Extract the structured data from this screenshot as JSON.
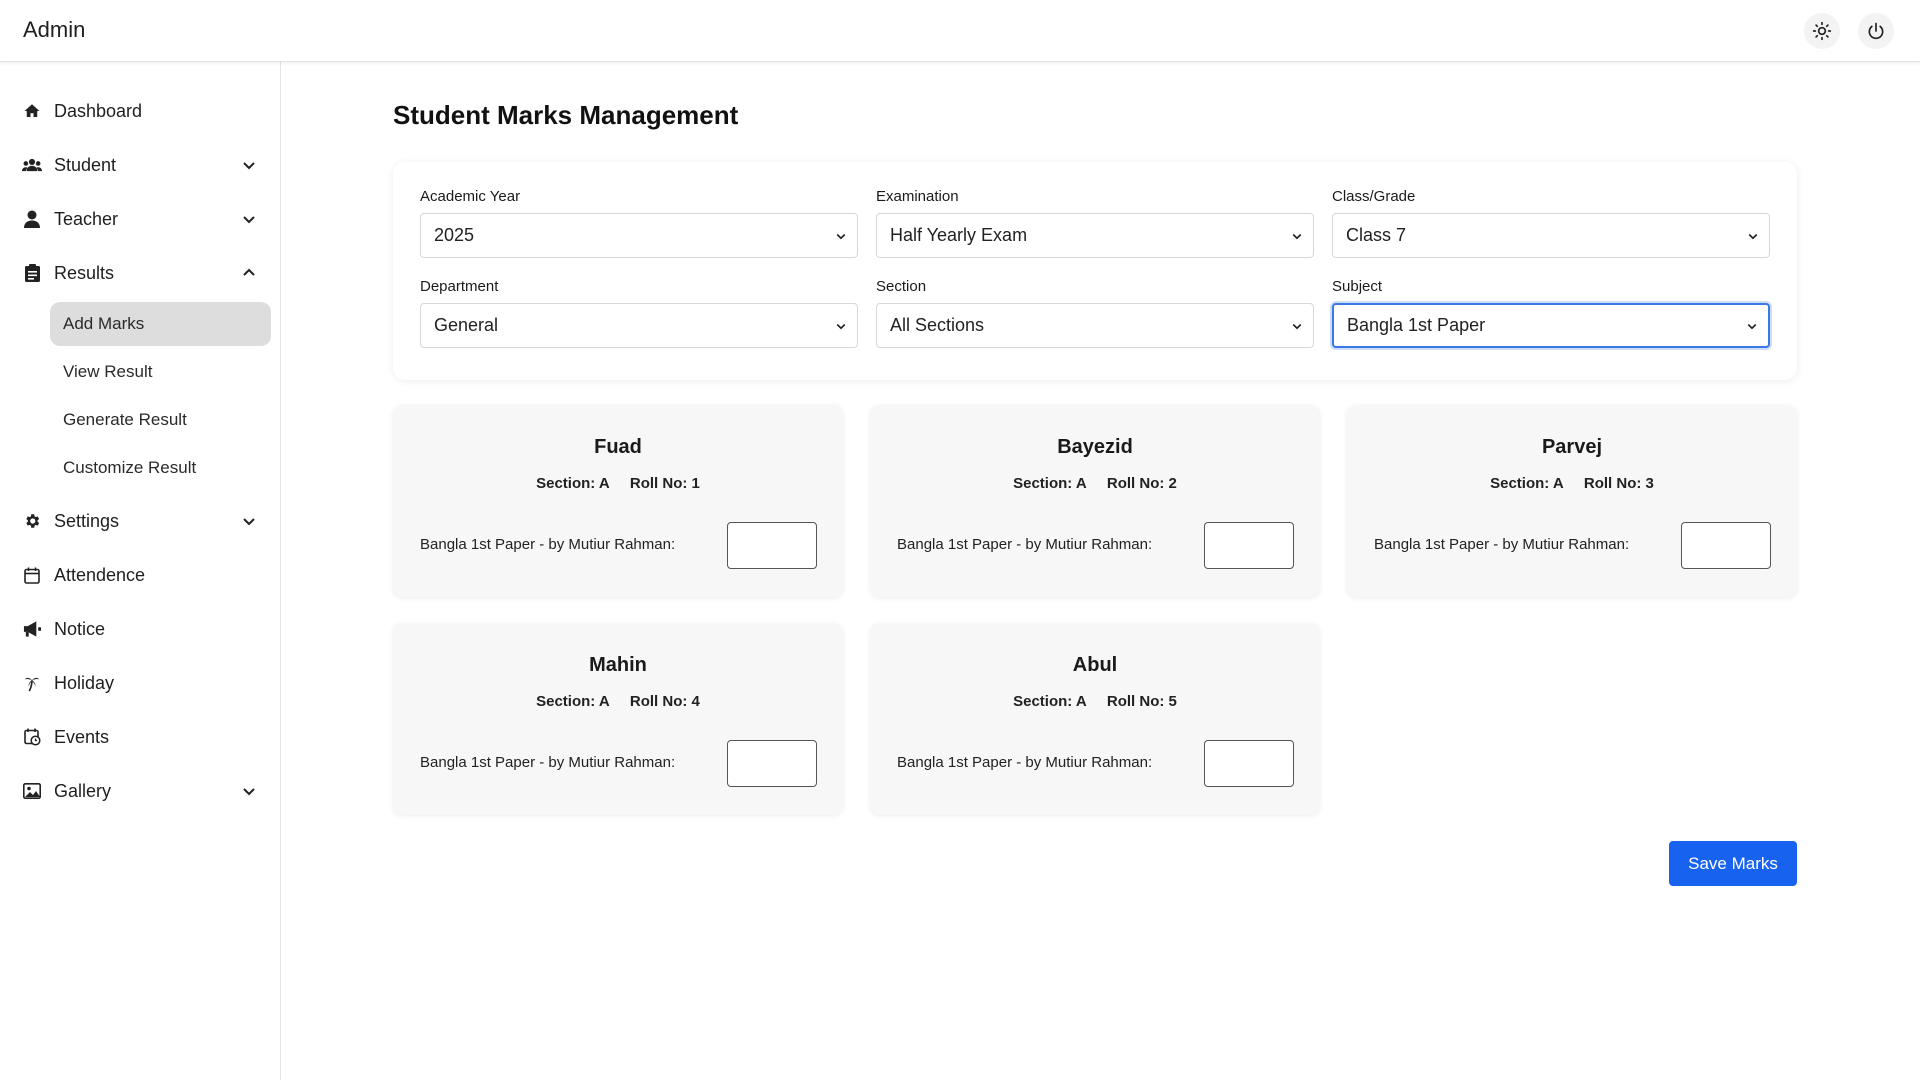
{
  "app": {
    "title": "Admin"
  },
  "header": {
    "theme_icon": "sun-icon",
    "logout_icon": "power-icon"
  },
  "sidebar": {
    "items": [
      {
        "label": "Dashboard",
        "icon": "home-icon"
      },
      {
        "label": "Student",
        "icon": "users-icon"
      },
      {
        "label": "Teacher",
        "icon": "user-icon"
      },
      {
        "label": "Results",
        "icon": "clipboard-icon"
      },
      {
        "label": "Settings",
        "icon": "gear-icon"
      },
      {
        "label": "Attendence",
        "icon": "calendar-icon"
      },
      {
        "label": "Notice",
        "icon": "megaphone-icon"
      },
      {
        "label": "Holiday",
        "icon": "palm-tree-icon"
      },
      {
        "label": "Events",
        "icon": "calendar-clock-icon"
      },
      {
        "label": "Gallery",
        "icon": "image-icon"
      }
    ],
    "results_sub": [
      {
        "label": "Add Marks",
        "active": true
      },
      {
        "label": "View Result"
      },
      {
        "label": "Generate Result"
      },
      {
        "label": "Customize Result"
      }
    ]
  },
  "page": {
    "title": "Student Marks Management"
  },
  "filters": {
    "academic_year": {
      "label": "Academic Year",
      "value": "2025"
    },
    "examination": {
      "label": "Examination",
      "value": "Half Yearly Exam"
    },
    "class_grade": {
      "label": "Class/Grade",
      "value": "Class 7"
    },
    "department": {
      "label": "Department",
      "value": "General"
    },
    "section": {
      "label": "Section",
      "value": "All Sections"
    },
    "subject": {
      "label": "Subject",
      "value": "Bangla 1st Paper"
    }
  },
  "students": [
    {
      "name": "Fuad",
      "section": "Section: A",
      "roll": "Roll No: 1",
      "mark_label": "Bangla 1st Paper - by Mutiur Rahman:",
      "mark_value": ""
    },
    {
      "name": "Bayezid",
      "section": "Section: A",
      "roll": "Roll No: 2",
      "mark_label": "Bangla 1st Paper - by Mutiur Rahman:",
      "mark_value": ""
    },
    {
      "name": "Parvej",
      "section": "Section: A",
      "roll": "Roll No: 3",
      "mark_label": "Bangla 1st Paper - by Mutiur Rahman:",
      "mark_value": ""
    },
    {
      "name": "Mahin",
      "section": "Section: A",
      "roll": "Roll No: 4",
      "mark_label": "Bangla 1st Paper - by Mutiur Rahman:",
      "mark_value": ""
    },
    {
      "name": "Abul",
      "section": "Section: A",
      "roll": "Roll No: 5",
      "mark_label": "Bangla 1st Paper - by Mutiur Rahman:",
      "mark_value": ""
    }
  ],
  "actions": {
    "save_label": "Save Marks"
  },
  "colors": {
    "accent": "#1763f0",
    "active_bg": "#dddddd",
    "card_bg": "#f7f7f7"
  }
}
